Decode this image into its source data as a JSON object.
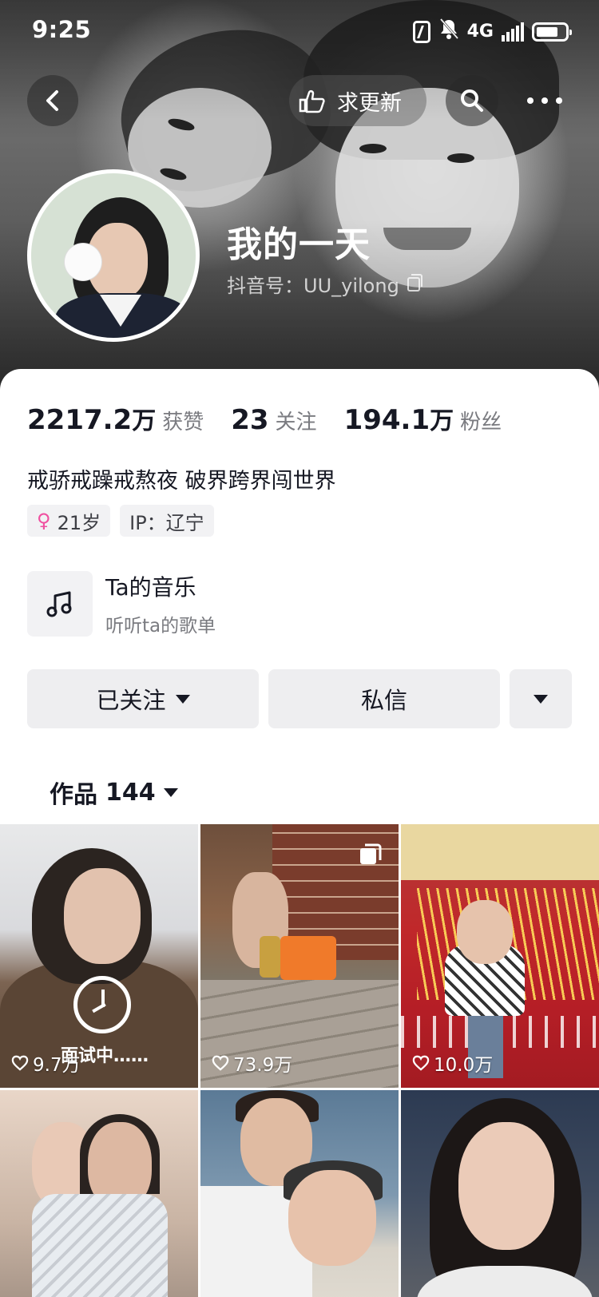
{
  "status_bar": {
    "time": "9:25",
    "network": "4G"
  },
  "nav": {
    "update_label": "求更新"
  },
  "profile": {
    "name": "我的一天",
    "douyin_id": "抖音号：UU_yilong"
  },
  "stats": [
    {
      "num": "2217.2",
      "unit": "万",
      "label": "获赞"
    },
    {
      "num": "23",
      "unit": "",
      "label": "关注"
    },
    {
      "num": "194.1",
      "unit": "万",
      "label": "粉丝"
    }
  ],
  "bio": "戒骄戒躁戒熬夜 破界跨界闯世界",
  "tags": {
    "age": "21岁",
    "ip": "IP：辽宁"
  },
  "music": {
    "title": "Ta的音乐",
    "subtitle": "听听ta的歌单"
  },
  "actions": {
    "follow_label": "已关注",
    "message_label": "私信"
  },
  "works_tab": {
    "label": "作品",
    "count": "144"
  },
  "videos": [
    {
      "likes": "9.7万",
      "overlay_text": "面试中……"
    },
    {
      "likes": "73.9万",
      "overlay_text": ""
    },
    {
      "likes": "10.0万",
      "overlay_text": ""
    },
    {
      "likes": "",
      "overlay_text": ""
    },
    {
      "likes": "",
      "overlay_text": ""
    },
    {
      "likes": "",
      "overlay_text": ""
    }
  ],
  "colors": {
    "female_accent": "#f04fa0",
    "button_bg": "#eeeef0",
    "secondary_text": "#7a7b80"
  }
}
